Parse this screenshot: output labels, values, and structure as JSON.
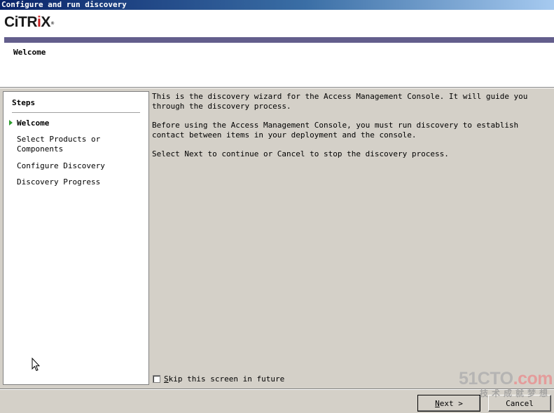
{
  "window": {
    "title": "Configure and run discovery"
  },
  "header": {
    "logo_prefix": "CiTR",
    "logo_accent": "i",
    "logo_suffix": "X",
    "page_title": "Welcome"
  },
  "steps": {
    "heading": "Steps",
    "items": [
      {
        "label": "Welcome",
        "current": true
      },
      {
        "label": "Select Products or Components",
        "current": false
      },
      {
        "label": "Configure Discovery",
        "current": false
      },
      {
        "label": "Discovery Progress",
        "current": false
      }
    ]
  },
  "content": {
    "paragraphs": [
      "This is the discovery wizard for the Access Management Console.  It will guide you through the discovery process.",
      "Before using the Access Management Console, you must run discovery to establish contact between items in your deployment and the console.",
      "Select Next to continue or Cancel to stop the discovery process."
    ]
  },
  "skip": {
    "label_mnemonic": "S",
    "label_rest": "kip this screen in future",
    "checked": false
  },
  "buttons": {
    "next_mnemonic": "N",
    "next_rest": "ext >",
    "cancel_label": "Cancel"
  },
  "watermark": {
    "main_a": "51CTO",
    "main_b": ".com",
    "sub": "技术成就梦想"
  }
}
